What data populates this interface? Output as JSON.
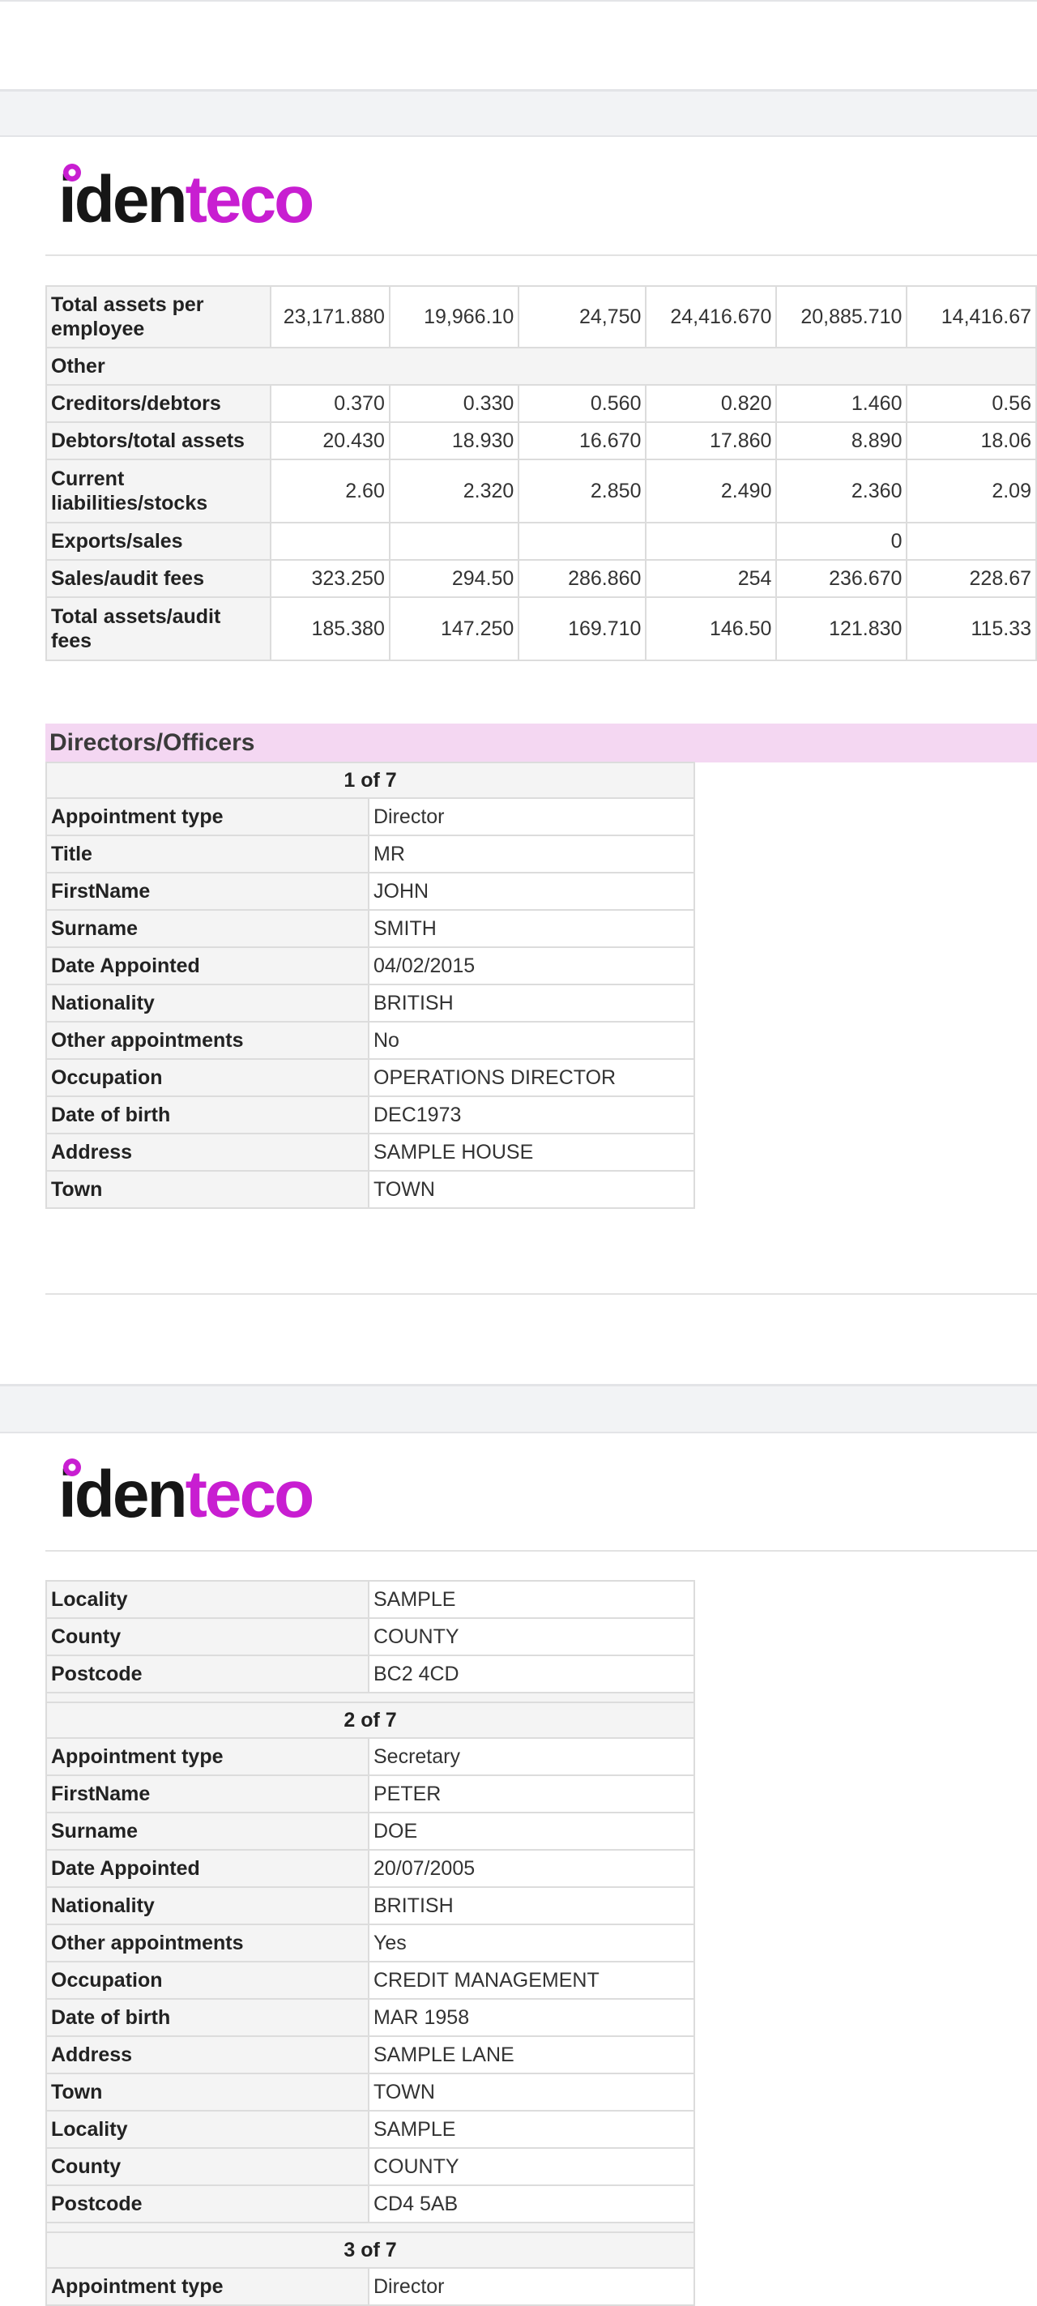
{
  "brand": {
    "logo_dark": "iden",
    "logo_pink": "teco",
    "pink": "#c81ed1",
    "dark": "#161616"
  },
  "ratios": {
    "rows": [
      {
        "label": "Total assets per employee",
        "values": [
          "23,171.880",
          "19,966.10",
          "24,750",
          "24,416.670",
          "20,885.710",
          "14,416.67"
        ]
      },
      {
        "label": "Other",
        "values": []
      },
      {
        "label": "Creditors/debtors",
        "values": [
          "0.370",
          "0.330",
          "0.560",
          "0.820",
          "1.460",
          "0.56"
        ]
      },
      {
        "label": "Debtors/total assets",
        "values": [
          "20.430",
          "18.930",
          "16.670",
          "17.860",
          "8.890",
          "18.06"
        ]
      },
      {
        "label": "Current liabilities/stocks",
        "values": [
          "2.60",
          "2.320",
          "2.850",
          "2.490",
          "2.360",
          "2.09"
        ]
      },
      {
        "label": "Exports/sales",
        "values": [
          "",
          "",
          "",
          "",
          "0",
          ""
        ]
      },
      {
        "label": "Sales/audit fees",
        "values": [
          "323.250",
          "294.50",
          "286.860",
          "254",
          "236.670",
          "228.67"
        ]
      },
      {
        "label": "Total assets/audit fees",
        "values": [
          "185.380",
          "147.250",
          "169.710",
          "146.50",
          "121.830",
          "115.33"
        ]
      }
    ]
  },
  "officers": {
    "section_title": "Directors/Officers",
    "officer1": {
      "header": "1 of 7",
      "rows": [
        {
          "label": "Appointment type",
          "value": "Director"
        },
        {
          "label": "Title",
          "value": "MR"
        },
        {
          "label": "FirstName",
          "value": "JOHN"
        },
        {
          "label": "Surname",
          "value": "SMITH"
        },
        {
          "label": "Date Appointed",
          "value": "04/02/2015"
        },
        {
          "label": "Nationality",
          "value": "BRITISH"
        },
        {
          "label": "Other appointments",
          "value": "No"
        },
        {
          "label": "Occupation",
          "value": "OPERATIONS DIRECTOR"
        },
        {
          "label": "Date of birth",
          "value": "DEC1973"
        },
        {
          "label": "Address",
          "value": "SAMPLE HOUSE"
        },
        {
          "label": "Town",
          "value": "TOWN"
        }
      ],
      "continued": [
        {
          "label": "Locality",
          "value": "SAMPLE"
        },
        {
          "label": "County",
          "value": "COUNTY"
        },
        {
          "label": "Postcode",
          "value": "BC2 4CD"
        }
      ]
    },
    "officer2": {
      "header": "2 of 7",
      "rows": [
        {
          "label": "Appointment type",
          "value": "Secretary"
        },
        {
          "label": "FirstName",
          "value": "PETER"
        },
        {
          "label": "Surname",
          "value": "DOE"
        },
        {
          "label": "Date Appointed",
          "value": "20/07/2005"
        },
        {
          "label": "Nationality",
          "value": "BRITISH"
        },
        {
          "label": "Other appointments",
          "value": "Yes"
        },
        {
          "label": "Occupation",
          "value": "CREDIT MANAGEMENT"
        },
        {
          "label": "Date of birth",
          "value": "MAR 1958"
        },
        {
          "label": "Address",
          "value": "SAMPLE LANE"
        },
        {
          "label": "Town",
          "value": "TOWN"
        },
        {
          "label": "Locality",
          "value": "SAMPLE"
        },
        {
          "label": "County",
          "value": "COUNTY"
        },
        {
          "label": "Postcode",
          "value": "CD4 5AB"
        }
      ]
    },
    "officer3": {
      "header": "3 of 7",
      "rows": [
        {
          "label": "Appointment type",
          "value": "Director"
        }
      ]
    }
  }
}
